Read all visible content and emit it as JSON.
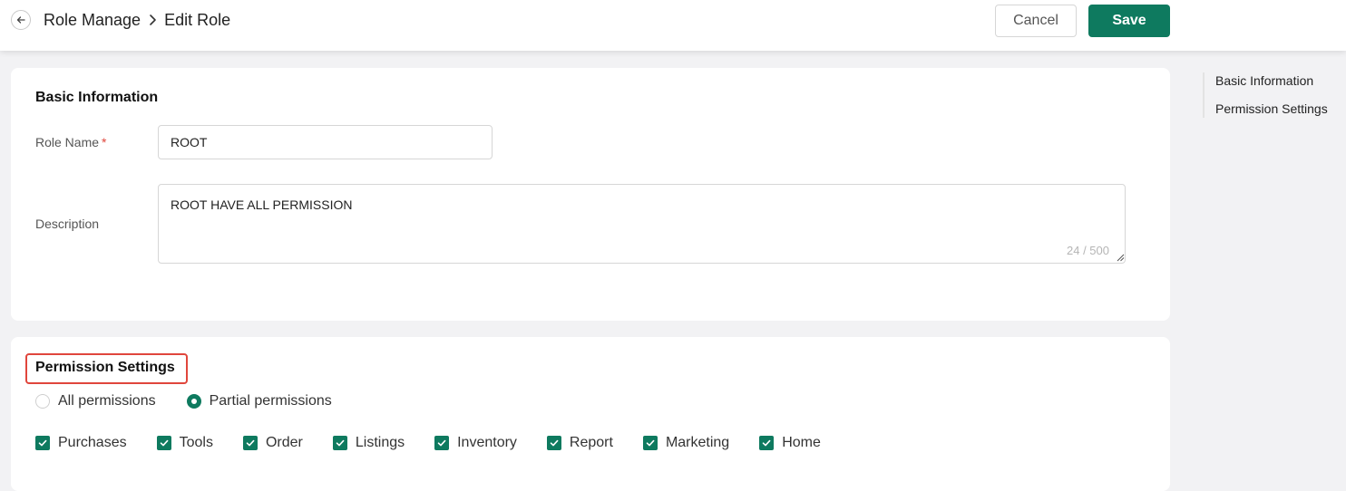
{
  "header": {
    "breadcrumb": [
      "Role Manage",
      "Edit Role"
    ],
    "cancel_label": "Cancel",
    "save_label": "Save"
  },
  "basic_info": {
    "title": "Basic Information",
    "role_name_label": "Role Name",
    "required_mark": "*",
    "role_name_value": "ROOT",
    "description_label": "Description",
    "description_value": "ROOT HAVE ALL PERMISSION",
    "description_counter": "24 / 500"
  },
  "permissions": {
    "title": "Permission Settings",
    "radio_options": [
      {
        "label": "All permissions",
        "selected": false
      },
      {
        "label": "Partial permissions",
        "selected": true
      }
    ],
    "modules": [
      {
        "label": "Purchases",
        "checked": true
      },
      {
        "label": "Tools",
        "checked": true
      },
      {
        "label": "Order",
        "checked": true
      },
      {
        "label": "Listings",
        "checked": true
      },
      {
        "label": "Inventory",
        "checked": true
      },
      {
        "label": "Report",
        "checked": true
      },
      {
        "label": "Marketing",
        "checked": true
      },
      {
        "label": "Home",
        "checked": true
      }
    ]
  },
  "anchor_nav": {
    "items": [
      "Basic Information",
      "Permission Settings"
    ]
  },
  "colors": {
    "primary": "#0e7a5f",
    "highlight_border": "#e0463c",
    "background": "#f2f2f4"
  },
  "icons": {
    "back": "arrow-left-icon",
    "separator": "chevron-right-icon",
    "checkbox": "checkmark-icon",
    "resize": "resize-grip-icon"
  }
}
